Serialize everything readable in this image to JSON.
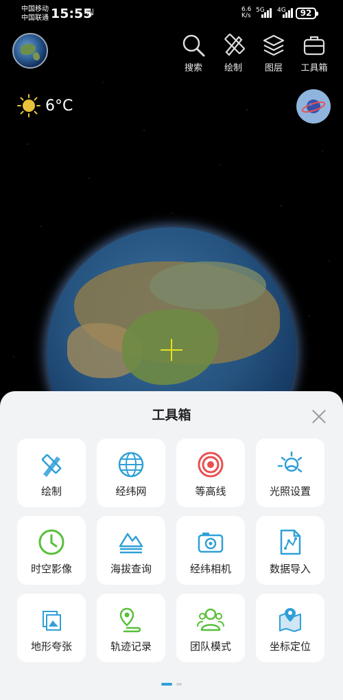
{
  "status_bar": {
    "carrier1": "中国移动",
    "carrier2": "中国联通",
    "time": "15:55",
    "speed_value": "6.6",
    "speed_unit": "K/s",
    "net1": "5G",
    "net2": "4G",
    "battery": "92"
  },
  "toolbar": {
    "search_label": "搜索",
    "draw_label": "绘制",
    "layers_label": "图层",
    "toolbox_label": "工具箱"
  },
  "weather": {
    "temperature": "6°C"
  },
  "panel": {
    "title": "工具箱",
    "tools": [
      {
        "label": "绘制",
        "icon": "draw-icon"
      },
      {
        "label": "经纬网",
        "icon": "globe-grid-icon"
      },
      {
        "label": "等高线",
        "icon": "contour-icon"
      },
      {
        "label": "光照设置",
        "icon": "lighting-icon"
      },
      {
        "label": "时空影像",
        "icon": "clock-icon"
      },
      {
        "label": "海拔查询",
        "icon": "mountain-icon"
      },
      {
        "label": "经纬相机",
        "icon": "camera-icon"
      },
      {
        "label": "数据导入",
        "icon": "file-import-icon"
      },
      {
        "label": "地形夸张",
        "icon": "terrain-exaggerate-icon"
      },
      {
        "label": "轨迹记录",
        "icon": "track-record-icon"
      },
      {
        "label": "团队模式",
        "icon": "team-icon"
      },
      {
        "label": "坐标定位",
        "icon": "coordinate-locate-icon"
      }
    ],
    "page_indicator": {
      "current": 1,
      "total": 2
    }
  },
  "colors": {
    "accent_blue": "#2f9fd8",
    "accent_green": "#56c038",
    "accent_red": "#e8504f",
    "crosshair": "#e6e021",
    "panel_bg": "#f2f3f5"
  }
}
